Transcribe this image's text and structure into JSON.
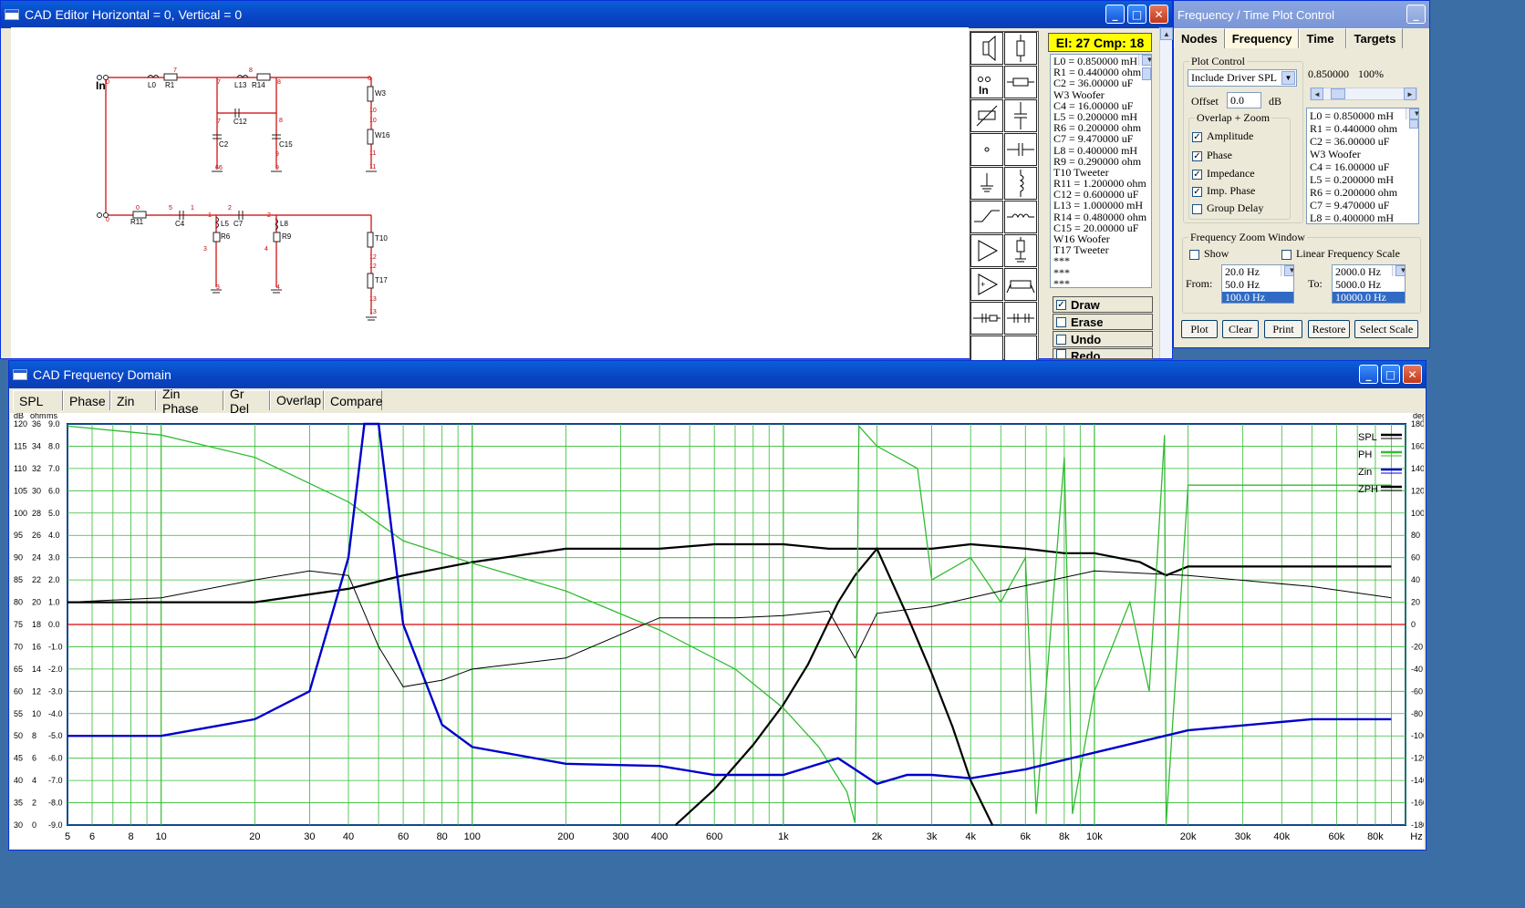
{
  "cad_editor": {
    "title": "CAD Editor  Horizontal = 0,  Vertical = 0",
    "element_count": "El: 27 Cmp: 18",
    "component_list": [
      "L0 = 0.850000 mH",
      "R1 = 0.440000 ohm",
      "C2 = 36.00000 uF",
      "W3 Woofer",
      "C4 = 16.00000 uF",
      "L5 = 0.200000 mH",
      "R6 = 0.200000 ohm",
      "C7 = 9.470000 uF",
      "L8 = 0.400000 mH",
      "R9 = 0.290000 ohm",
      "T10 Tweeter",
      "R11 = 1.200000 ohm",
      "C12 = 0.600000 uF",
      "L13 = 1.000000 mH",
      "R14 = 0.480000 ohm",
      "C15 = 20.00000 uF",
      "W16 Woofer",
      "T17 Tweeter",
      "***",
      "***",
      "***"
    ],
    "actions": [
      {
        "label": "Draw",
        "checked": true
      },
      {
        "label": "Erase",
        "checked": false
      },
      {
        "label": "Undo",
        "checked": false
      },
      {
        "label": "Redo",
        "checked": false
      }
    ],
    "schematic_labels": {
      "input": "In",
      "top": [
        "L0",
        "R1",
        "L13",
        "R14",
        "C12",
        "C2",
        "C15",
        "W3",
        "W16"
      ],
      "bottom": [
        "R11",
        "C4",
        "L5",
        "R6",
        "C7",
        "L8",
        "R9",
        "T10",
        "T17"
      ],
      "nodes": [
        "0",
        "7",
        "7",
        "8",
        "6",
        "6",
        "8",
        "7",
        "9",
        "9",
        "10",
        "10",
        "11",
        "11",
        "0",
        "5",
        "1",
        "1",
        "2",
        "2",
        "3",
        "4",
        "3",
        "4",
        "12",
        "12",
        "13",
        "13",
        "6",
        "8",
        "0"
      ]
    }
  },
  "plot_control": {
    "title": "Frequency / Time Plot Control",
    "tabs": [
      "Nodes",
      "Frequency",
      "Time",
      "Targets"
    ],
    "active_tab": "Frequency",
    "plot_control_label": "Plot Control",
    "driver_select": "Include Driver SPL",
    "offset_label": "Offset",
    "offset_value": "0.0",
    "offset_unit": "dB",
    "slider_value": "0.850000",
    "slider_pct": "100%",
    "overlap_label": "Overlap + Zoom",
    "options": [
      {
        "label": "Amplitude",
        "checked": true
      },
      {
        "label": "Phase",
        "checked": true
      },
      {
        "label": "Impedance",
        "checked": true
      },
      {
        "label": "Imp. Phase",
        "checked": true
      },
      {
        "label": "Group Delay",
        "checked": false
      }
    ],
    "component_list": [
      "L0 = 0.850000 mH",
      "R1 = 0.440000 ohm",
      "C2 = 36.00000 uF",
      "W3 Woofer",
      "C4 = 16.00000 uF",
      "L5 = 0.200000 mH",
      "R6 = 0.200000 ohm",
      "C7 = 9.470000 uF",
      "L8 = 0.400000 mH"
    ],
    "zoom_window_label": "Frequency Zoom Window",
    "show_label": "Show",
    "linear_label": "Linear Frequency Scale",
    "from_label": "From:",
    "to_label": "To:",
    "from_list": [
      "20.0 Hz",
      "50.0 Hz",
      "100.0 Hz"
    ],
    "to_list": [
      "2000.0 Hz",
      "5000.0 Hz",
      "10000.0 Hz"
    ],
    "buttons": [
      "Plot",
      "Clear",
      "Print",
      "Restore",
      "Select Scale"
    ]
  },
  "freq_domain": {
    "title": "CAD Frequency Domain",
    "tabs": [
      "SPL",
      "Phase",
      "Zin",
      "Zin Phase",
      "Gr Del",
      "Overlap",
      "Compare"
    ],
    "active_tab": "Overlap",
    "axis_units_left": [
      "dB",
      "ohm",
      "ms"
    ],
    "axis_unit_right": "deg",
    "db_ticks": [
      "120",
      "115",
      "110",
      "105",
      "100",
      "95",
      "90",
      "85",
      "80",
      "75",
      "70",
      "65",
      "60",
      "55",
      "50",
      "45",
      "40",
      "35",
      "30"
    ],
    "ohm_ticks": [
      "36",
      "34",
      "32",
      "30",
      "28",
      "26",
      "24",
      "22",
      "20",
      "18",
      "16",
      "14",
      "12",
      "10",
      "8",
      "6",
      "4",
      "2",
      "0"
    ],
    "ms_ticks": [
      "9.0",
      "8.0",
      "7.0",
      "6.0",
      "5.0",
      "4.0",
      "3.0",
      "2.0",
      "1.0",
      "0.0",
      "-1.0",
      "-2.0",
      "-3.0",
      "-4.0",
      "-5.0",
      "-6.0",
      "-7.0",
      "-8.0",
      "-9.0"
    ],
    "deg_ticks": [
      "180",
      "160",
      "140",
      "120",
      "100",
      "80",
      "60",
      "40",
      "20",
      "0",
      "-20",
      "-40",
      "-60",
      "-80",
      "-100",
      "-120",
      "-140",
      "-160",
      "-180"
    ],
    "x_ticks": [
      "5",
      "6",
      "8",
      "10",
      "20",
      "30",
      "40",
      "60",
      "80",
      "100",
      "200",
      "300",
      "400",
      "600",
      "1k",
      "2k",
      "3k",
      "4k",
      "6k",
      "8k",
      "10k",
      "20k",
      "30k",
      "40k",
      "60k",
      "80k",
      "Hz"
    ],
    "legend": [
      {
        "name": "SPL",
        "color": "#000000"
      },
      {
        "name": "PH",
        "color": "#33bb33"
      },
      {
        "name": "Zin",
        "color": "#0000cc"
      },
      {
        "name": "ZPH",
        "color": "#000000"
      }
    ]
  },
  "chart_data": {
    "type": "line",
    "xscale": "log",
    "xlim": [
      5,
      100000
    ],
    "ylim": [
      30,
      120
    ],
    "ylabel": "dB",
    "grid": true,
    "reference_line_db": 75,
    "series": [
      {
        "name": "SPL",
        "color": "#000000",
        "x": [
          5,
          10,
          20,
          40,
          60,
          100,
          200,
          400,
          600,
          1000,
          1400,
          1700,
          2000,
          3000,
          4000,
          6000,
          8000,
          10000,
          14000,
          17000,
          20000,
          50000,
          90000
        ],
        "y": [
          80,
          80,
          80,
          83,
          86,
          89,
          92,
          92,
          93,
          93,
          92,
          92,
          92,
          92,
          93,
          92,
          91,
          91,
          89,
          86,
          88,
          88,
          88
        ]
      },
      {
        "name": "W3 Woofer",
        "color": "#000000",
        "x": [
          450,
          600,
          800,
          1000,
          1200,
          1500,
          1700
        ],
        "y": [
          30,
          38,
          48,
          57,
          66,
          80,
          86
        ]
      },
      {
        "name": "T10 Tweeter",
        "color": "#000000",
        "x": [
          1700,
          2000,
          2500,
          3000,
          3500,
          4000,
          4700
        ],
        "y": [
          86,
          92,
          77,
          64,
          52,
          40,
          30
        ]
      },
      {
        "name": "PH",
        "color": "#33bb33",
        "x": [
          5,
          10,
          20,
          40,
          60,
          100,
          200,
          400,
          700,
          1000,
          1300,
          1600,
          1700,
          1750,
          2000,
          2700,
          3000,
          4000,
          5000,
          6000,
          6500,
          8000,
          8500,
          10000,
          13000,
          15000,
          16800,
          17000,
          20000,
          50000,
          90000
        ],
        "y": [
          178,
          170,
          150,
          110,
          75,
          55,
          30,
          -5,
          -40,
          -75,
          -110,
          -150,
          -178,
          178,
          160,
          140,
          40,
          60,
          20,
          60,
          -170,
          150,
          -170,
          -60,
          20,
          -60,
          170,
          -180,
          125,
          125,
          125
        ]
      },
      {
        "name": "Zin",
        "color": "#0000cc",
        "x": [
          5,
          10,
          20,
          30,
          40,
          45,
          50,
          60,
          80,
          100,
          200,
          400,
          600,
          1000,
          1500,
          1700,
          2000,
          2500,
          3000,
          4000,
          6000,
          10000,
          20000,
          50000,
          90000
        ],
        "y": [
          8,
          8,
          9.5,
          12,
          24,
          36,
          36,
          18,
          9,
          7,
          5.5,
          5.3,
          4.5,
          4.5,
          6,
          5,
          3.7,
          4.5,
          4.5,
          4.2,
          5,
          6.5,
          8.5,
          9.5,
          9.5
        ]
      },
      {
        "name": "ZPH",
        "color": "#000000",
        "x": [
          5,
          10,
          20,
          30,
          40,
          50,
          60,
          80,
          100,
          200,
          400,
          700,
          1000,
          1400,
          1700,
          2000,
          3000,
          5000,
          10000,
          20000,
          50000,
          90000
        ],
        "y": [
          1,
          1.2,
          2,
          2.4,
          2.2,
          -1,
          -2.8,
          -2.5,
          -2,
          -1.5,
          0.3,
          0.3,
          0.4,
          0.6,
          -1.5,
          0.5,
          0.8,
          1.5,
          2.4,
          2.2,
          1.7,
          1.2
        ]
      }
    ]
  }
}
